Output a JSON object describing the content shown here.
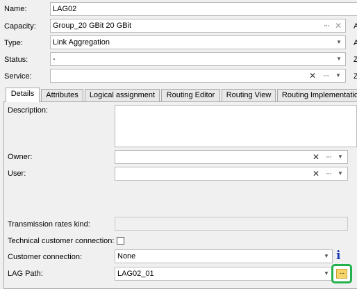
{
  "header": {
    "name": {
      "label": "Name:",
      "value": "LAG02"
    },
    "capacity": {
      "label": "Capacity:",
      "value": "Group_20 GBit 20 GBit"
    },
    "type": {
      "label": "Type:",
      "value": "Link Aggregation"
    },
    "status": {
      "label": "Status:",
      "value": "-"
    },
    "service": {
      "label": "Service:",
      "value": ""
    },
    "right_cut_labels": [
      "A",
      "A",
      "Z",
      "Z"
    ]
  },
  "tabs": [
    {
      "label": "Details",
      "active": true
    },
    {
      "label": "Attributes"
    },
    {
      "label": "Logical assignment"
    },
    {
      "label": "Routing Editor"
    },
    {
      "label": "Routing View"
    },
    {
      "label": "Routing Implementation"
    }
  ],
  "details": {
    "description_label": "Description:",
    "description_value": "",
    "owner_label": "Owner:",
    "owner_value": "",
    "user_label": "User:",
    "user_value": "",
    "transmission_rates_kind_label": "Transmission rates kind:",
    "transmission_rates_kind_value": "",
    "technical_customer_connection_label": "Technical customer connection:",
    "technical_customer_connection_checked": false,
    "customer_connection_label": "Customer connection:",
    "customer_connection_value": "None",
    "info_icon_glyph": "i",
    "lag_path_label": "LAG Path:",
    "lag_path_value": "LAG02_01"
  },
  "controls": {
    "clear_glyph": "✕",
    "more_glyph": "···",
    "dropdown_glyph": "▼"
  },
  "colors": {
    "highlight": "#22b14c",
    "info": "#1a3bb5",
    "more_button": "#f7d46a"
  }
}
